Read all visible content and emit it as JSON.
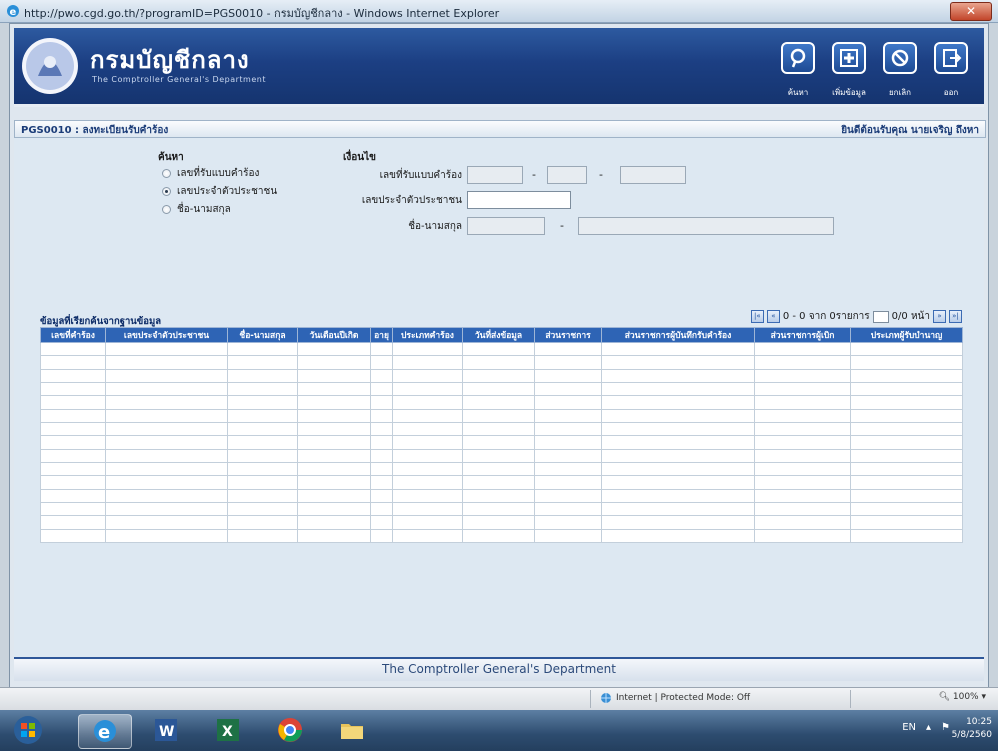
{
  "browser": {
    "title": "http://pwo.cgd.go.th/?programID=PGS0010 - กรมบัญชีกลาง - Windows Internet Explorer",
    "close_glyph": "✕",
    "status_zone": "Internet | Protected Mode: Off",
    "zoom": "100%"
  },
  "header": {
    "brand_th": "กรมบัญชีกลาง",
    "brand_en": "The Comptroller General's Department",
    "tools": [
      {
        "label": "ค้นหา",
        "icon": "search-icon"
      },
      {
        "label": "เพิ่มข้อมูล",
        "icon": "add-icon"
      },
      {
        "label": "ยกเลิก",
        "icon": "cancel-icon"
      },
      {
        "label": "ออก",
        "icon": "exit-icon"
      }
    ]
  },
  "page": {
    "title": "PGS0010 : ลงทะเบียนรับคำร้อง",
    "welcome": "ยินดีต้อนรับคุณ นายเจริญ ถึงหา"
  },
  "search": {
    "title": "ค้นหา",
    "options": [
      {
        "label": "เลขที่รับแบบคำร้อง",
        "selected": false
      },
      {
        "label": "เลขประจำตัวประชาชน",
        "selected": true
      },
      {
        "label": "ชื่อ-นามสกุล",
        "selected": false
      }
    ]
  },
  "condition": {
    "title": "เงื่อนไข",
    "request_no_label": "เลขที่รับแบบคำร้อง",
    "citizen_id_label": "เลขประจำตัวประชาชน",
    "name_label": "ชื่อ-นามสกุล",
    "separator": "-"
  },
  "grid": {
    "title": "ข้อมูลที่เรียกค้นจากฐานข้อมูล",
    "pager_text_pre": "0 - 0 จาก 0รายการ",
    "pager_page_label": "0/0 หน้า",
    "first": "|«",
    "prev": "«",
    "next": "»",
    "last": "»|",
    "columns": [
      "เลขที่คำร้อง",
      "เลขประจำตัวประชาชน",
      "ชื่อ-นามสกุล",
      "วันเดือนปีเกิด",
      "อายุ",
      "ประเภทคำร้อง",
      "วันที่ส่งข้อมูล",
      "ส่วนราชการ",
      "ส่วนราชการผู้บันทึกรับคำร้อง",
      "ส่วนราชการผู้เบิก",
      "ประเภทผู้รับบำนาญ"
    ],
    "row_count": 15
  },
  "footer": {
    "text": "The Comptroller General's Department"
  },
  "taskbar": {
    "time": "10:25",
    "date": "5/8/2560",
    "lang": "EN"
  }
}
